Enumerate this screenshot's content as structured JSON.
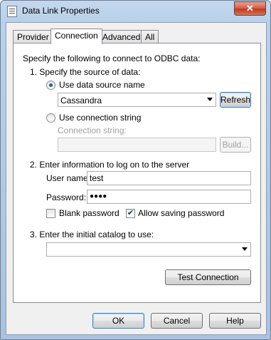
{
  "window": {
    "title": "Data Link Properties",
    "close_symbol": "✕"
  },
  "tabs": [
    {
      "label": "Provider"
    },
    {
      "label": "Connection",
      "active": true
    },
    {
      "label": "Advanced"
    },
    {
      "label": "All"
    }
  ],
  "connection": {
    "intro": "Specify the following to connect to ODBC data:",
    "step1": "1. Specify the source of data:",
    "use_dsn_label": "Use data source name",
    "dsn_value": "Cassandra",
    "refresh_label": "Refresh",
    "use_conn_string_label": "Use connection string",
    "conn_string_label": "Connection string:",
    "conn_string_value": "",
    "build_label": "Build...",
    "step2": "2. Enter information to log on to the server",
    "username_label": "User name:",
    "username_value": "test",
    "password_label": "Password:",
    "password_value": "●●●●",
    "blank_password_label": "Blank password",
    "blank_password_checked": false,
    "allow_saving_label": "Allow saving password",
    "allow_saving_checked": true,
    "check_mark": "✔",
    "step3": "3. Enter the initial catalog to use:",
    "catalog_value": "",
    "test_connection_label": "Test Connection"
  },
  "footer": {
    "ok_label": "OK",
    "cancel_label": "Cancel",
    "help_label": "Help"
  }
}
